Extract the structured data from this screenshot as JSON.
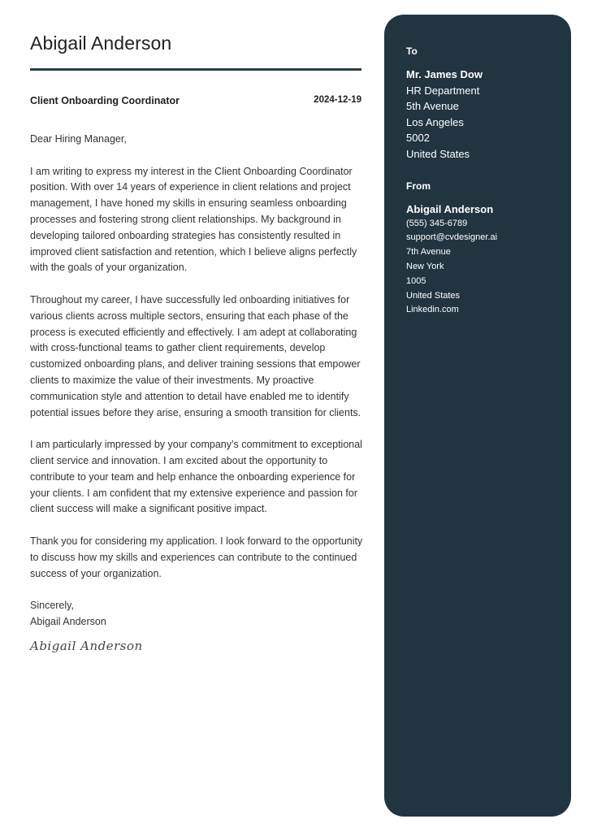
{
  "header": {
    "name": "Abigail Anderson",
    "job_title": "Client Onboarding Coordinator",
    "date": "2024-12-19"
  },
  "letter": {
    "salutation": "Dear Hiring Manager,",
    "paragraphs": [
      "I am writing to express my interest in the Client Onboarding Coordinator position. With over 14 years of experience in client relations and project management, I have honed my skills in ensuring seamless onboarding processes and fostering strong client relationships. My background in developing tailored onboarding strategies has consistently resulted in improved client satisfaction and retention, which I believe aligns perfectly with the goals of your organization.",
      "Throughout my career, I have successfully led onboarding initiatives for various clients across multiple sectors, ensuring that each phase of the process is executed efficiently and effectively. I am adept at collaborating with cross-functional teams to gather client requirements, develop customized onboarding plans, and deliver training sessions that empower clients to maximize the value of their investments. My proactive communication style and attention to detail have enabled me to identify potential issues before they arise, ensuring a smooth transition for clients.",
      "I am particularly impressed by your company’s commitment to exceptional client service and innovation. I am excited about the opportunity to contribute to your team and help enhance the onboarding experience for your clients. I am confident that my extensive experience and passion for client success will make a significant positive impact.",
      "Thank you for considering my application. I look forward to the opportunity to discuss how my skills and experiences can contribute to the continued success of your organization."
    ],
    "closing": "Sincerely,",
    "closing_name": "Abigail Anderson",
    "signature": "Abigail Anderson"
  },
  "sidebar": {
    "to": {
      "heading": "To",
      "name": "Mr. James Dow",
      "lines": [
        "HR Department",
        "5th Avenue",
        "Los Angeles",
        "5002",
        "United States"
      ]
    },
    "from": {
      "heading": "From",
      "name": "Abigail Anderson",
      "lines": [
        "(555) 345-6789",
        "support@cvdesigner.ai",
        "7th Avenue",
        "New York",
        "1005",
        "United States",
        "Linkedin.com"
      ]
    }
  },
  "colors": {
    "sidebar_bg": "#213540",
    "rule": "#2b3e48"
  }
}
